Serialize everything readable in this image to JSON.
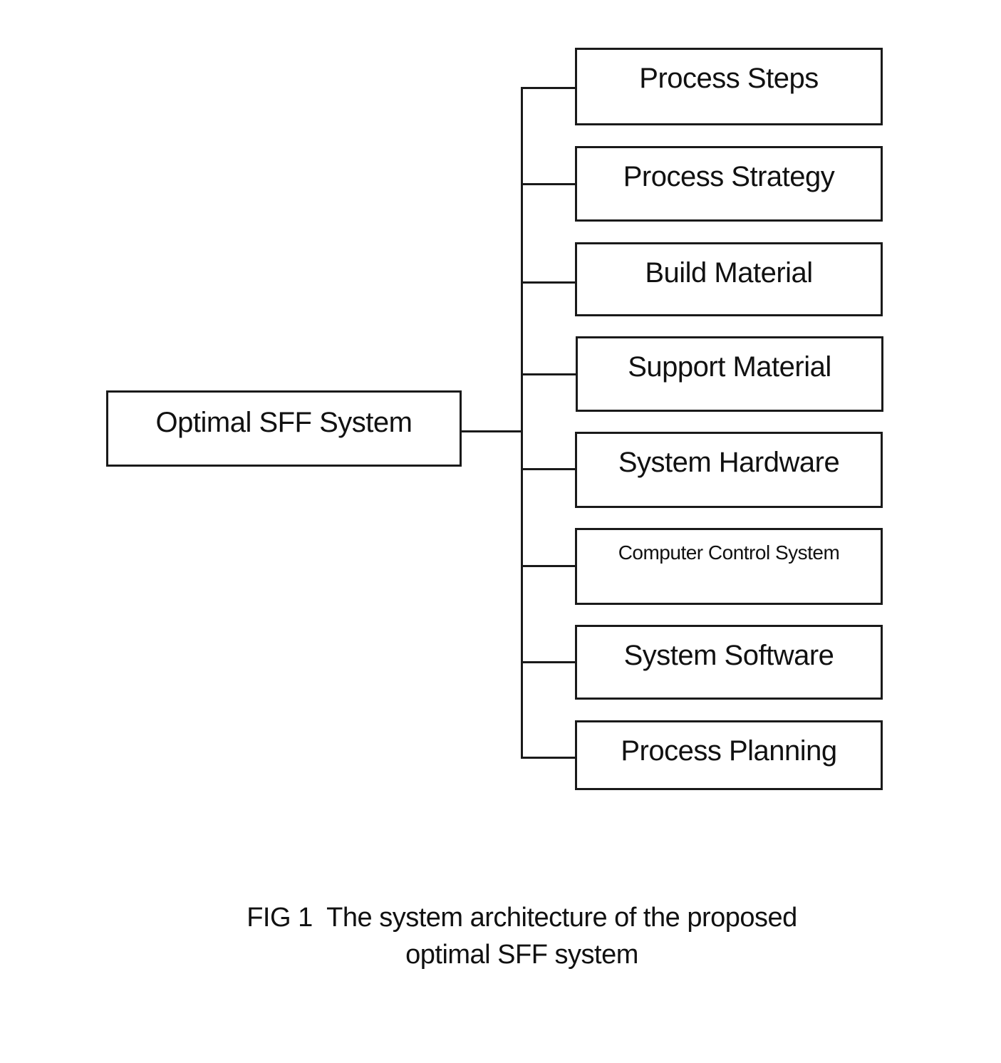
{
  "diagram": {
    "root": {
      "label": "Optimal SFF System"
    },
    "children": [
      {
        "label": "Process Steps"
      },
      {
        "label": "Process Strategy"
      },
      {
        "label": "Build Material"
      },
      {
        "label": "Support Material"
      },
      {
        "label": "System Hardware"
      },
      {
        "label": "Computer Control System"
      },
      {
        "label": "System Software"
      },
      {
        "label": "Process Planning"
      }
    ]
  },
  "caption": {
    "line1": "FIG 1  The system architecture of the proposed",
    "line2": "optimal SFF system"
  }
}
